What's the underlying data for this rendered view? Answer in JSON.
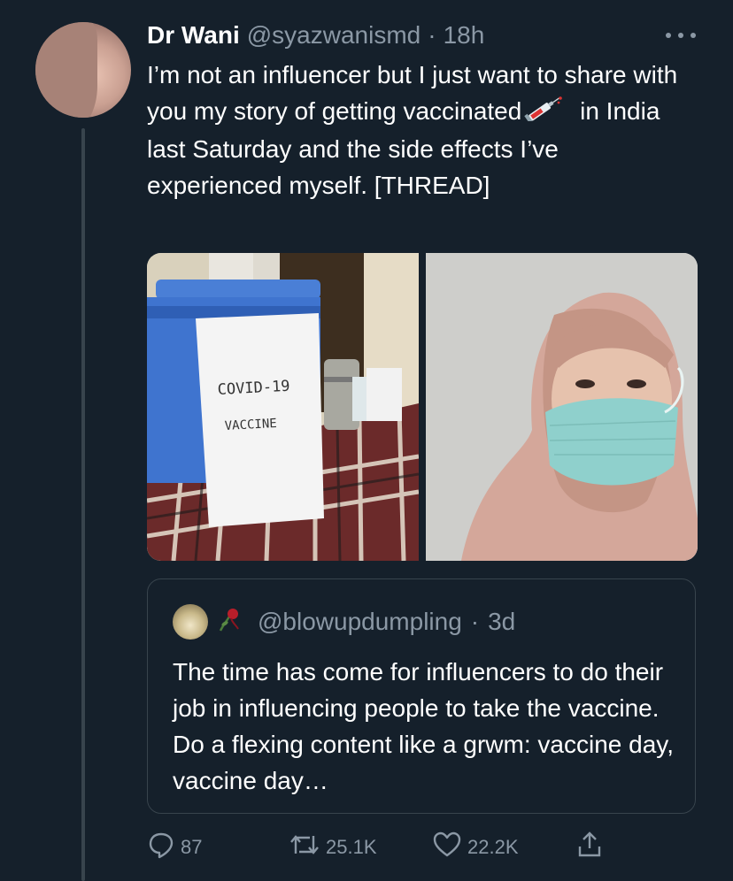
{
  "tweet": {
    "display_name": "Dr Wani",
    "handle": "@syazwanismd",
    "separator": "·",
    "time": "18h",
    "text_before_emoji": "I’m not an influencer but I just want to share with you my story of getting vaccinated",
    "emoji_name": "syringe-icon",
    "text_after_emoji": " in India last Saturday and the side effects I’ve experienced myself. [THREAD]"
  },
  "media": {
    "left_photo": {
      "sign_line1": "COVID-19",
      "sign_line2": "VACCINE"
    },
    "right_photo": {}
  },
  "quoted_tweet": {
    "handle": "@blowupdumpling",
    "separator": "·",
    "time": "3d",
    "text": "The time has come for influencers to do their job in influencing people to take the vaccine. Do a flexing content like a grwm: vaccine day, vaccine day…"
  },
  "actions": {
    "replies": "87",
    "retweets": "25.1K",
    "likes": "22.2K"
  },
  "colors": {
    "background": "#15202b",
    "secondary_text": "#8b98a5",
    "border": "#38444d"
  }
}
